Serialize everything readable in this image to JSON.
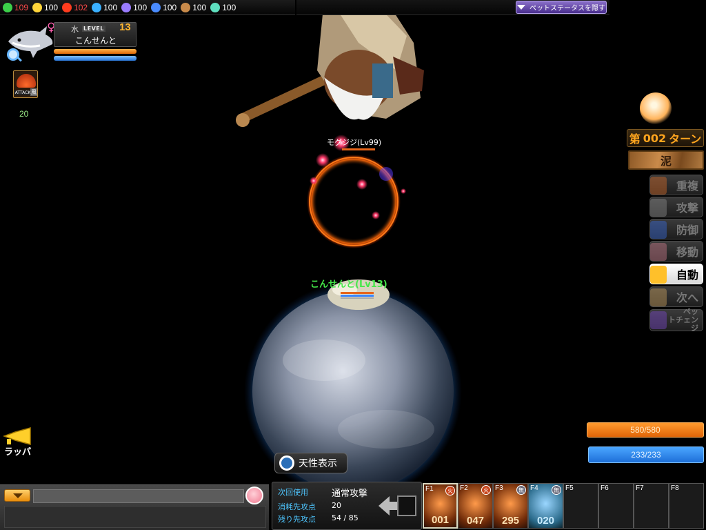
{
  "resources": [
    {
      "icon": "green-crystal-icon",
      "color": "#3ccf4a",
      "value": "109",
      "value_color": "#ff4b4b"
    },
    {
      "icon": "star-icon",
      "color": "#ffd53a",
      "value": "100",
      "value_color": "#ffffff"
    },
    {
      "icon": "fire-icon",
      "color": "#ff3c1e",
      "value": "102",
      "value_color": "#ff4b4b"
    },
    {
      "icon": "water-drop-icon",
      "color": "#3ab0ff",
      "value": "100",
      "value_color": "#ffffff"
    },
    {
      "icon": "moon-icon",
      "color": "#9a7cff",
      "value": "100",
      "value_color": "#ffffff"
    },
    {
      "icon": "target-icon",
      "color": "#4a8cff",
      "value": "100",
      "value_color": "#ffffff"
    },
    {
      "icon": "mountain-icon",
      "color": "#c88a4a",
      "value": "100",
      "value_color": "#ffffff"
    },
    {
      "icon": "wind-icon",
      "color": "#5fe0c0",
      "value": "100",
      "value_color": "#ffffff"
    }
  ],
  "hide_pet_status_label": "ペットステータスを隠す",
  "pet": {
    "element": "水",
    "level_label": "LEVEL",
    "level": "13",
    "name": "こんせんと",
    "hp_fraction": 1.0,
    "mp_fraction": 1.0
  },
  "skill": {
    "icon_label": "ATTACK",
    "element": "風",
    "count": "20"
  },
  "enemy": {
    "name_label": "モグジジ(Lv99)"
  },
  "player": {
    "name_label": "こんせんと(Lv13)"
  },
  "turn": {
    "prefix": "第",
    "number": "002",
    "suffix": "ターン"
  },
  "terrain": "泥",
  "commands": [
    {
      "label": "重複",
      "icon": "repeat-icon",
      "active": false
    },
    {
      "label": "攻撃",
      "icon": "sword-icon",
      "active": false
    },
    {
      "label": "防御",
      "icon": "shield-icon",
      "active": false
    },
    {
      "label": "移動",
      "icon": "wing-icon",
      "active": false
    },
    {
      "label": "自動",
      "icon": "auto-icon",
      "active": true
    },
    {
      "label": "次へ",
      "icon": "hand-icon",
      "active": false
    },
    {
      "label": "ペットチェンジ",
      "icon": "pet-change-icon",
      "active": false
    }
  ],
  "total_hp": "580/580",
  "total_mp": "233/233",
  "horn_label": "ラッパ",
  "trait_label": "天性表示",
  "action": {
    "next_use_label": "次回使用",
    "next_use_value": "通常攻撃",
    "cost_label": "消耗先攻点",
    "cost_value": "20",
    "remaining_label": "残り先攻点",
    "remaining_value": "54 / 85"
  },
  "fslots": [
    {
      "key": "F1",
      "element": "火",
      "number": "001",
      "kind": "fire",
      "selected": true
    },
    {
      "key": "F2",
      "element": "火",
      "number": "047",
      "kind": "fire",
      "selected": false
    },
    {
      "key": "F3",
      "element": "無",
      "number": "295",
      "kind": "fire",
      "selected": false
    },
    {
      "key": "F4",
      "element": "無",
      "number": "020",
      "kind": "water",
      "selected": false
    },
    {
      "key": "F5",
      "element": "",
      "number": "",
      "kind": "empty",
      "selected": false
    },
    {
      "key": "F6",
      "element": "",
      "number": "",
      "kind": "empty",
      "selected": false
    },
    {
      "key": "F7",
      "element": "",
      "number": "",
      "kind": "empty",
      "selected": false
    },
    {
      "key": "F8",
      "element": "",
      "number": "",
      "kind": "empty",
      "selected": false
    }
  ]
}
